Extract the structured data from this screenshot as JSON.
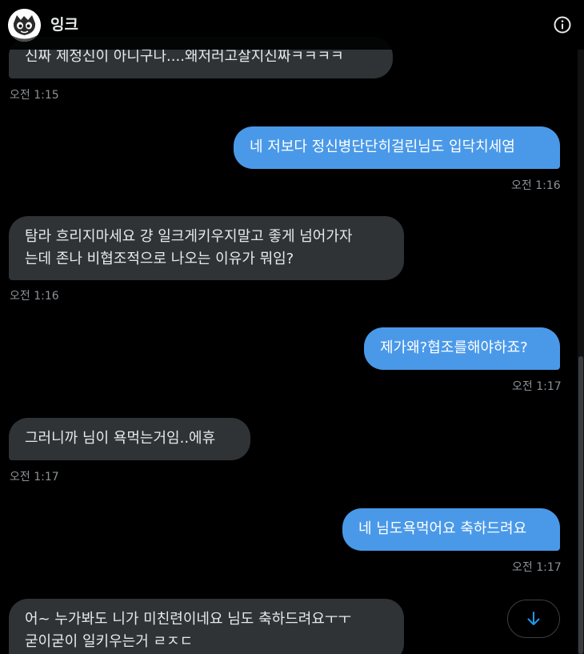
{
  "header": {
    "title": "잉크",
    "info_icon": "info-circle-icon"
  },
  "messages": [
    {
      "dir": "in",
      "text": "신짜 제정신이 아니구나....왜저러고살지신짜ㅋㅋㅋㅋ",
      "time": "오전 1:15"
    },
    {
      "dir": "out",
      "text": "네 저보다 정신병단단히걸린님도 입닥치세염",
      "time": "오전 1:16"
    },
    {
      "dir": "in",
      "lines": [
        "탐라 흐리지마세요 걍 일크게키우지말고 좋게 넘어가자",
        "는데 존나 비협조적으로 나오는 이유가 뭐임?"
      ],
      "time": "오전 1:16"
    },
    {
      "dir": "out",
      "text": "제가왜?협조를해야하죠?",
      "time": "오전 1:17"
    },
    {
      "dir": "in",
      "text": "그러니까 님이 욕먹는거임..에휴",
      "time": "오전 1:17"
    },
    {
      "dir": "out",
      "text": "네 님도욕먹어요 축하드려요",
      "time": "오전 1:17"
    },
    {
      "dir": "in",
      "lines": [
        "어~ 누가봐도 니가 미친련이네요 님도 축하드려요ㅜㅜ",
        "굳이굳이 일키우는거 ㄹㅈㄷ"
      ]
    }
  ],
  "scroll_down_icon": "arrow-down-icon",
  "colors": {
    "incoming": "#2f3336",
    "outgoing": "#4a99e9",
    "accent": "#1d9bf0"
  }
}
